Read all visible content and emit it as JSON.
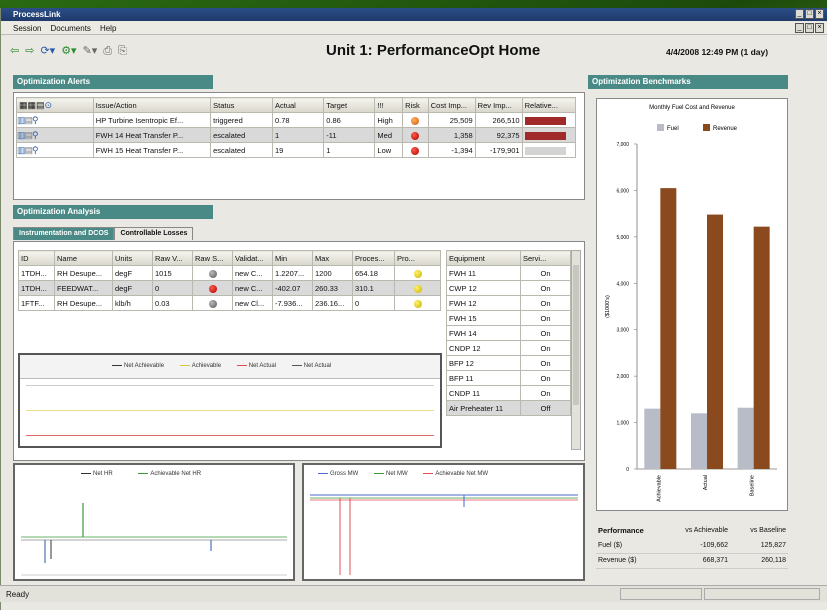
{
  "window": {
    "title": "ProcessLink"
  },
  "menu": [
    "Session",
    "Documents",
    "Help"
  ],
  "page_title": "Unit 1: PerformanceOpt Home",
  "datetime": "4/4/2008 12:49 PM (1 day)",
  "alerts": {
    "header": "Optimization Alerts",
    "columns": [
      "Issue/Action",
      "Status",
      "Actual",
      "Target",
      "!!!",
      "Risk",
      "Cost Imp...",
      "Rev Imp...",
      "Relative..."
    ],
    "rows": [
      {
        "issue": "HP Turbine Isentropic Ef...",
        "status": "triggered",
        "actual": "0.78",
        "target": "0.86",
        "pri": "High",
        "risk": "orange",
        "cost": "25,509",
        "rev": "266,510",
        "rel_color": "#a02a2a",
        "rel": 0.8
      },
      {
        "issue": "FWH 14 Heat Transfer P...",
        "status": "escalated",
        "actual": "1",
        "target": "-11",
        "pri": "Med",
        "risk": "red",
        "cost": "1,358",
        "rev": "92,375",
        "rel_color": "#a02a2a",
        "rel": 0.8
      },
      {
        "issue": "FWH 15 Heat Transfer P...",
        "status": "escalated",
        "actual": "19",
        "target": "1",
        "pri": "Low",
        "risk": "red",
        "cost": "-1,394",
        "rev": "-179,901",
        "rel_color": "#d4d4d4",
        "rel": 0.8
      }
    ]
  },
  "analysis": {
    "header": "Optimization Analysis",
    "tabs": [
      "Instrumentation and DCOS",
      "Controllable Losses"
    ],
    "columns": [
      "ID",
      "Name",
      "Units",
      "Raw V...",
      "Raw S...",
      "Validat...",
      "Min",
      "Max",
      "Proces...",
      "Pro..."
    ],
    "rows": [
      {
        "id": "1TDH...",
        "name": "RH Desupe...",
        "units": "degF",
        "raw": "1015",
        "rawdot": "gray",
        "valid": "new C...",
        "min": "1.2207...",
        "max": "1200",
        "proc": "654.18",
        "prodot": "yellow"
      },
      {
        "id": "1TDH...",
        "name": "FEEDWAT...",
        "units": "degF",
        "raw": "0",
        "rawdot": "red",
        "valid": "new C...",
        "min": "-402.07",
        "max": "260.33",
        "proc": "310.1",
        "prodot": "yellow"
      },
      {
        "id": "1FTF...",
        "name": "RH Desupe...",
        "units": "klb/h",
        "raw": "0.03",
        "rawdot": "gray",
        "valid": "new Cl...",
        "min": "-7.936...",
        "max": "236.16...",
        "proc": "0",
        "prodot": "yellow"
      }
    ],
    "equipment_columns": [
      "Equipment",
      "Servi..."
    ],
    "equipment": [
      {
        "name": "FWH 11",
        "status": "On"
      },
      {
        "name": "CWP 12",
        "status": "On"
      },
      {
        "name": "FWH 12",
        "status": "On"
      },
      {
        "name": "FWH 15",
        "status": "On"
      },
      {
        "name": "FWH 14",
        "status": "On"
      },
      {
        "name": "CNDP 12",
        "status": "On"
      },
      {
        "name": "BFP 12",
        "status": "On"
      },
      {
        "name": "BFP 11",
        "status": "On"
      },
      {
        "name": "CNDP 11",
        "status": "On"
      },
      {
        "name": "Air Preheater 11",
        "status": "Off"
      }
    ]
  },
  "trend_top": {
    "legend": [
      "Net Achievable",
      "Achievable",
      "Net Actual",
      "Net Actual"
    ],
    "colors": [
      "#333",
      "#d4c640",
      "#e05050",
      "#555"
    ]
  },
  "trend_left": {
    "legend": [
      "Net HR",
      "Achievable Net HR"
    ],
    "colors": [
      "#333",
      "#3a9a3a"
    ]
  },
  "trend_right": {
    "legend": [
      "Gross MW",
      "Net MW",
      "Achievable Net MW"
    ],
    "colors": [
      "#4a6ad0",
      "#3a9a3a",
      "#e05050"
    ]
  },
  "benchmarks": {
    "header": "Optimization Benchmarks",
    "table_header": [
      "Performance",
      "vs Achievable",
      "vs Baseline"
    ],
    "rows": [
      {
        "label": "Fuel ($)",
        "vs_ach": "-109,662",
        "vs_base": "125,827"
      },
      {
        "label": "Revenue ($)",
        "vs_ach": "668,371",
        "vs_base": "260,118"
      }
    ]
  },
  "chart_data": {
    "type": "bar",
    "title": "Monthly Fuel Cost and Revenue",
    "ylabel": "($1000's)",
    "categories": [
      "Achievable",
      "Actual",
      "Baseline"
    ],
    "series": [
      {
        "name": "Fuel",
        "color": "#b8bcc6",
        "values": [
          1300,
          1200,
          1320
        ]
      },
      {
        "name": "Revenue",
        "color": "#8a4a1e",
        "values": [
          6050,
          5480,
          5220
        ]
      }
    ],
    "ylim": [
      0,
      7000
    ],
    "yticks": [
      "0",
      "1,000",
      "2,000",
      "3,000",
      "4,000",
      "5,000",
      "6,000",
      "7,000"
    ]
  },
  "status": "Ready"
}
